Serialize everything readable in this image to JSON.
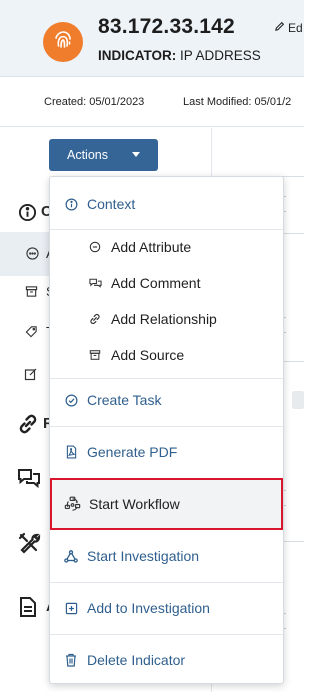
{
  "header": {
    "title": "83.172.33.142",
    "indicator_label": "INDICATOR:",
    "indicator_type": "IP ADDRESS",
    "edit_label": "Ed"
  },
  "dates": {
    "created": "Created: 05/01/2023",
    "last_modified": "Last Modified: 05/01/2"
  },
  "actions": {
    "label": "Actions"
  },
  "menu": {
    "context": "Context",
    "add_attribute": "Add Attribute",
    "add_comment": "Add Comment",
    "add_relationship": "Add Relationship",
    "add_source": "Add Source",
    "create_task": "Create Task",
    "generate_pdf": "Generate PDF",
    "start_workflow": "Start Workflow",
    "start_investigation": "Start Investigation",
    "add_to_investigation": "Add to Investigation",
    "delete_indicator": "Delete Indicator"
  },
  "sidebar_fragments": {
    "c": "C",
    "a": "A",
    "s": "S",
    "t": "T",
    "r": "R",
    "a2": "A"
  },
  "colors": {
    "accent": "#346596",
    "menu_text_blue": "#2f5f8e",
    "avatar": "#ef7d2c",
    "highlight_border": "#d8172f"
  }
}
